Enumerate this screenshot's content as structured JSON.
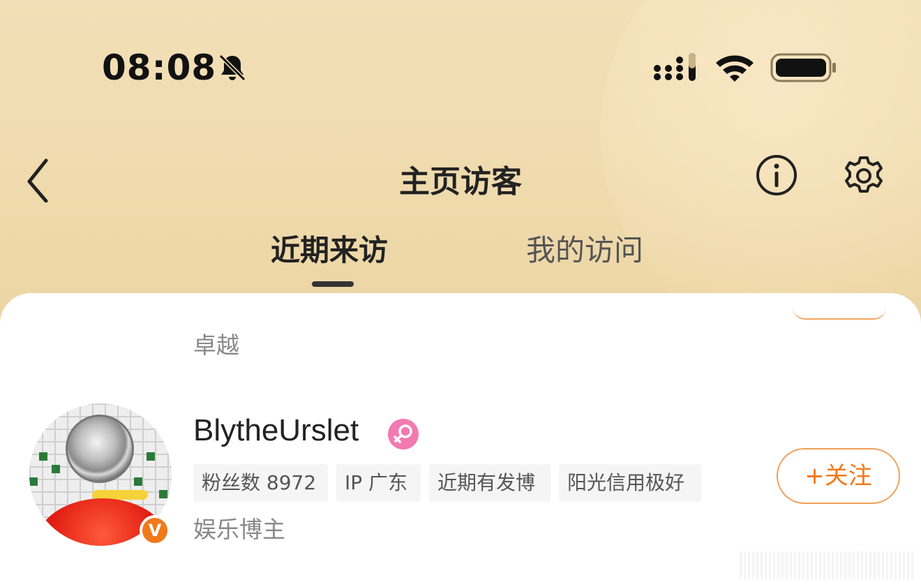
{
  "status_bar": {
    "time": "08:08",
    "icons": [
      "bell-off-icon",
      "signal-icon",
      "wifi-icon",
      "battery-icon"
    ]
  },
  "nav": {
    "title": "主页访客",
    "icons": [
      "back-icon",
      "info-icon",
      "gear-icon"
    ]
  },
  "tabs": [
    {
      "label": "近期来访",
      "active": true
    },
    {
      "label": "我的访问",
      "active": false
    }
  ],
  "previous_item": {
    "subtitle": "卓越"
  },
  "visitor": {
    "username": "BlytheUrslet",
    "verified_mark": "V",
    "gender_icon": "female-icon",
    "tags": [
      "粉丝数 8972",
      "IP 广东",
      "近期有发博",
      "阳光信用极好"
    ],
    "description": "娱乐博主",
    "follow_label": "+关注"
  },
  "colors": {
    "header_bg": "#f0dcb0",
    "accent_orange": "#f07a1a",
    "gender_pink": "#f27ab0"
  }
}
